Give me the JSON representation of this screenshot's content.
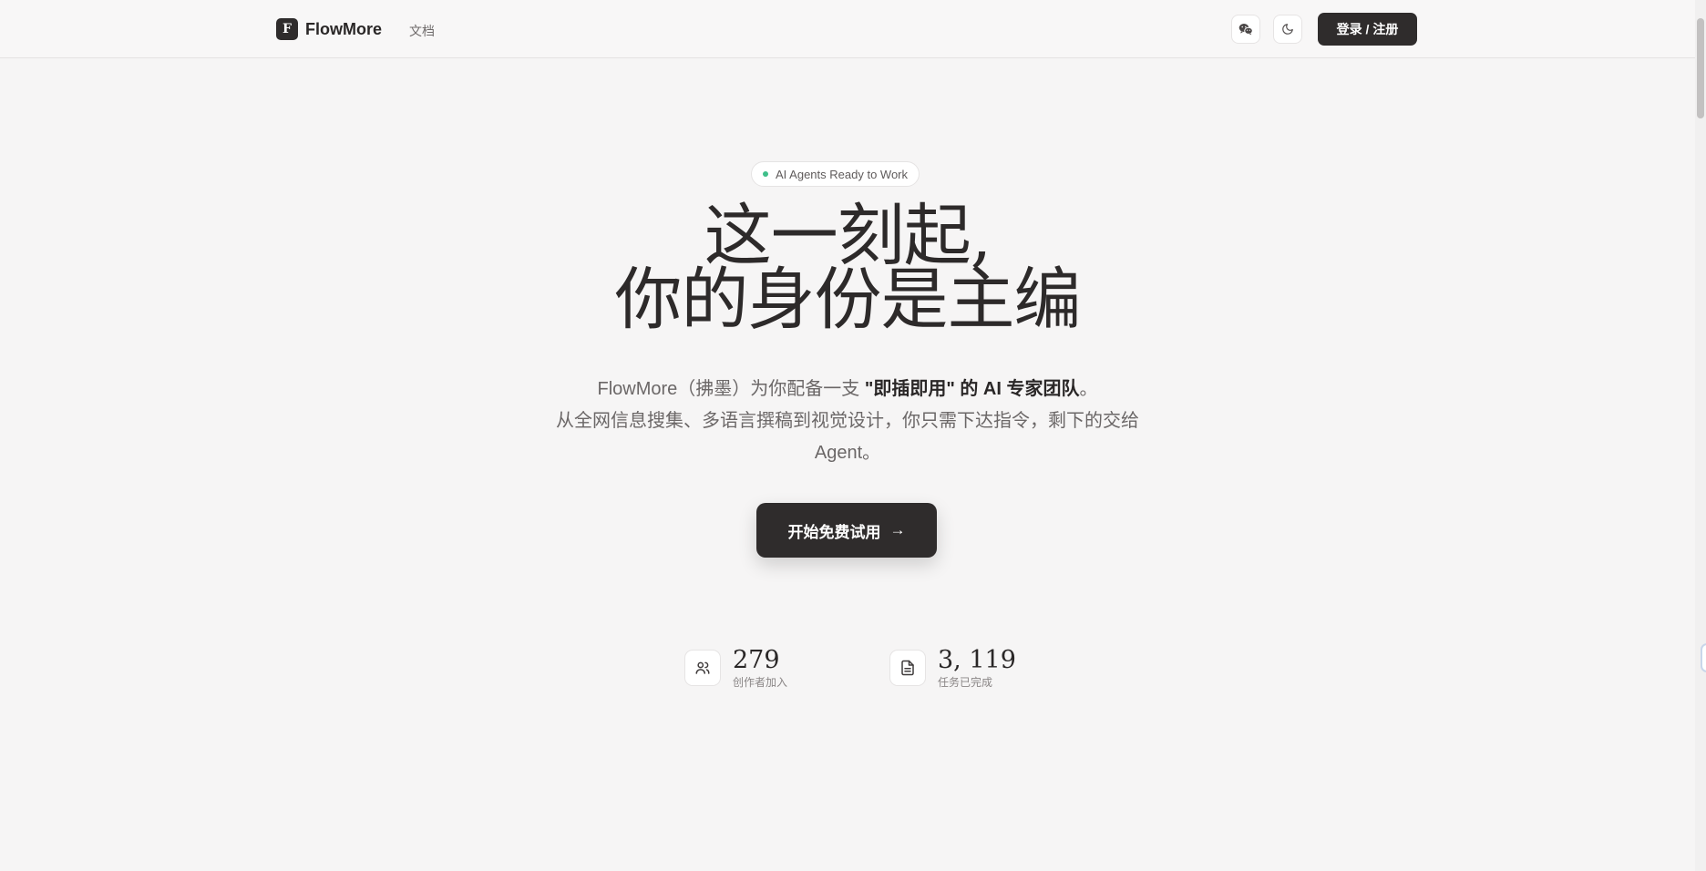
{
  "header": {
    "brand_mark": "F",
    "brand_name": "FlowMore",
    "nav_docs": "文档",
    "login_label": "登录 / 注册"
  },
  "hero": {
    "badge": "AI Agents Ready to Work",
    "title_line1": "这一刻起,",
    "title_line2": "你的身份是主编",
    "sub_prefix": "FlowMore（拂墨）为你配备一支",
    "sub_strong": "\"即插即用\" 的 AI 专家团队",
    "sub_suffix": "。",
    "sub_line2": "从全网信息搜集、多语言撰稿到视觉设计，你只需下达指令，剩下的交给",
    "sub_line3": "Agent。",
    "cta_label": "开始免费试用",
    "cta_arrow": "→"
  },
  "stats": [
    {
      "value": "279",
      "label": "创作者加入",
      "icon": "users-icon"
    },
    {
      "value": "3, 119",
      "label": "任务已完成",
      "icon": "document-icon"
    }
  ],
  "colors": {
    "background": "#f6f5f5",
    "primary_dark": "#2f2c2c",
    "badge_dot": "#3fbf8a"
  }
}
